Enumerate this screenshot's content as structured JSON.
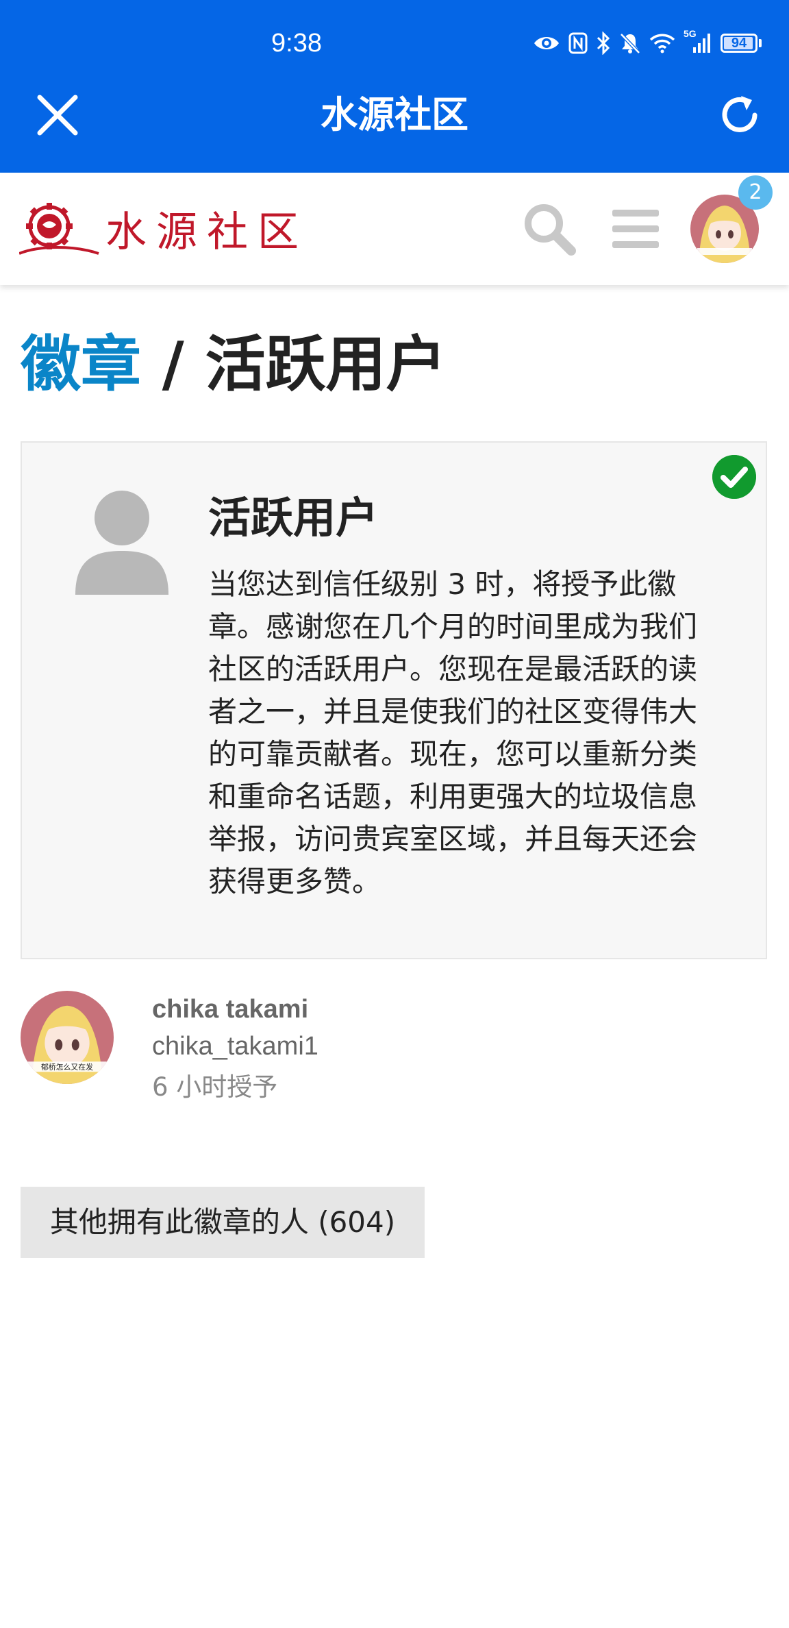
{
  "status_bar": {
    "time": "9:38",
    "network": "5G",
    "battery": "94",
    "icons": [
      "eye-icon",
      "nfc-icon",
      "bluetooth-icon",
      "mute-icon",
      "wifi-icon",
      "signal-icon",
      "battery-icon"
    ]
  },
  "app_bar": {
    "title": "水源社区",
    "close_icon": "close-icon",
    "refresh_icon": "refresh-icon",
    "background": "#0566e6"
  },
  "site_header": {
    "logo_text": "水源社区",
    "logo_color": "#c0182a",
    "search_icon": "search-icon",
    "menu_icon": "hamburger-menu-icon",
    "notification_count": "2"
  },
  "breadcrumb": {
    "parent": "徽章",
    "separator": " / ",
    "current": "活跃用户",
    "link_color": "#0a85c8"
  },
  "badge": {
    "name": "活跃用户",
    "description": "当您达到信任级别 3 时，将授予此徽章。感谢您在几个月的时间里成为我们社区的活跃用户。您现在是最活跃的读者之一，并且是使我们的社区变得伟大的可靠贡献者。现在，您可以重新分类和重命名话题，利用更强大的垃圾信息举报，访问贵宾室区域，并且每天还会获得更多赞。",
    "icon": "user-icon",
    "granted_icon": "checkmark-icon",
    "granted_color": "#119a2e"
  },
  "grant": {
    "name": "chika takami",
    "username": "chika_takami1",
    "time": "6 小时授予",
    "avatar_caption": "郁桥怎么又在发"
  },
  "others_button": {
    "label": "其他拥有此徽章的人 (604)"
  }
}
